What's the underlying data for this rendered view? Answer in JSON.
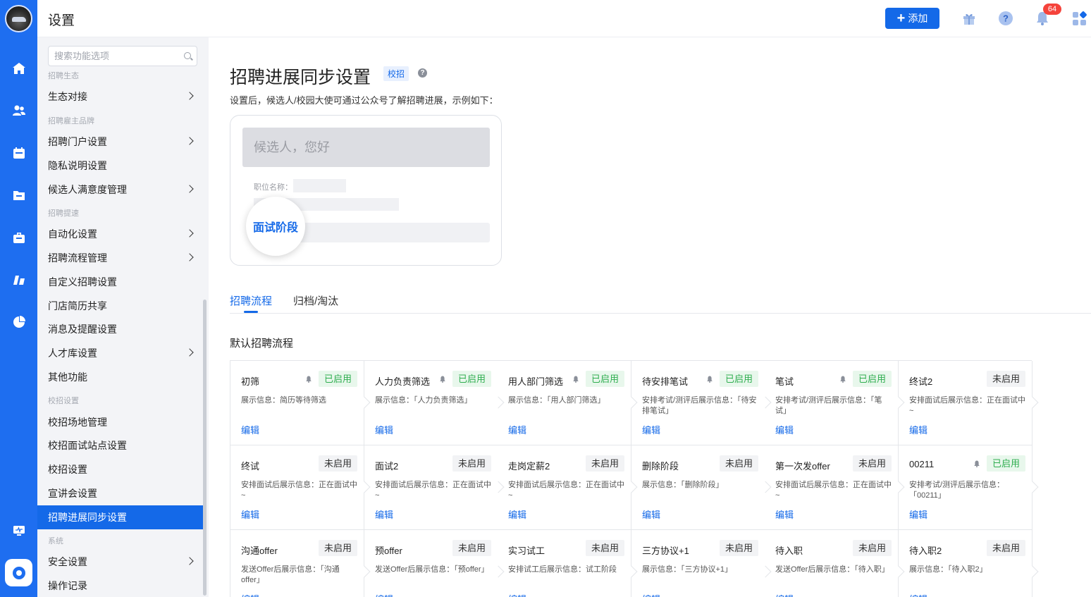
{
  "header": {
    "title": "设置",
    "add_label": "添加",
    "notification_count": "64"
  },
  "sidebar": {
    "search_placeholder": "搜索功能选项",
    "groups": {
      "eco": "招聘生态",
      "brand": "招聘雇主品牌",
      "speed": "招聘提速",
      "campus": "校招设置",
      "system": "系统"
    },
    "items": {
      "eco_connect": "生态对接",
      "portal": "招聘门户设置",
      "privacy": "隐私说明设置",
      "satisfaction": "候选人满意度管理",
      "automation": "自动化设置",
      "process": "招聘流程管理",
      "custom": "自定义招聘设置",
      "store_share": "门店简历共享",
      "notify": "消息及提醒设置",
      "talent": "人才库设置",
      "other": "其他功能",
      "campus_venue": "校招场地管理",
      "campus_site": "校招面试站点设置",
      "campus_settings": "校招设置",
      "seminar": "宣讲会设置",
      "sync": "招聘进展同步设置",
      "security": "安全设置",
      "oplog": "操作记录"
    }
  },
  "main": {
    "title": "招聘进展同步设置",
    "tag": "校招",
    "description": "设置后，候选人/校园大使可通过公众号了解招聘进展，示例如下：",
    "preview": {
      "greeting": "候选人，您好",
      "field_label": "职位名称：",
      "stage_label": "面试阶段"
    },
    "tabs": [
      "招聘流程",
      "归档/淘汰"
    ],
    "section_title": "默认招聘流程",
    "edit_label": "编辑",
    "cards": [
      [
        {
          "name": "初筛",
          "status": "已启用",
          "on": true,
          "info": "展示信息：简历等待筛选"
        },
        {
          "name": "人力负责筛选",
          "status": "已启用",
          "on": true,
          "info": "展示信息：「人力负责筛选」"
        },
        {
          "name": "用人部门筛选",
          "status": "已启用",
          "on": true,
          "info": "展示信息：「用人部门筛选」"
        },
        {
          "name": "待安排笔试",
          "status": "已启用",
          "on": true,
          "info": "安排考试/测评后展示信息：「待安排笔试」"
        },
        {
          "name": "笔试",
          "status": "已启用",
          "on": true,
          "info": "安排考试/测评后展示信息：「笔试」"
        },
        {
          "name": "终试2",
          "status": "未启用",
          "on": false,
          "info": "安排面试后展示信息：正在面试中~"
        }
      ],
      [
        {
          "name": "终试",
          "status": "未启用",
          "on": false,
          "info": "安排面试后展示信息：正在面试中~"
        },
        {
          "name": "面试2",
          "status": "未启用",
          "on": false,
          "info": "安排面试后展示信息：正在面试中~"
        },
        {
          "name": "走岗定薪2",
          "status": "未启用",
          "on": false,
          "info": "安排面试后展示信息：正在面试中~"
        },
        {
          "name": "删除阶段",
          "status": "未启用",
          "on": false,
          "info": "展示信息：「删除阶段」"
        },
        {
          "name": "第一次发offer",
          "status": "未启用",
          "on": false,
          "info": "安排面试后展示信息：正在面试中~"
        },
        {
          "name": "00211",
          "status": "已启用",
          "on": true,
          "info": "安排考试/测评后展示信息：「00211」"
        }
      ],
      [
        {
          "name": "沟通offer",
          "status": "未启用",
          "on": false,
          "info": "发送Offer后展示信息：「沟通offer」"
        },
        {
          "name": "预offer",
          "status": "未启用",
          "on": false,
          "info": "发送Offer后展示信息：「预offer」"
        },
        {
          "name": "实习试工",
          "status": "未启用",
          "on": false,
          "info": "安排试工后展示信息：试工阶段"
        },
        {
          "name": "三方协议+1",
          "status": "未启用",
          "on": false,
          "info": "展示信息：「三方协议+1」"
        },
        {
          "name": "待入职",
          "status": "未启用",
          "on": false,
          "info": "发送Offer后展示信息：「待入职」"
        },
        {
          "name": "待入职2",
          "status": "未启用",
          "on": false,
          "info": "展示信息：「待入职2」"
        }
      ]
    ]
  },
  "colors": {
    "primary": "#1469e8",
    "rail": "#1e6ef0",
    "enabled_bg": "#e8f7ec",
    "enabled_text": "#2fae4f",
    "badge": "#f5433b"
  }
}
